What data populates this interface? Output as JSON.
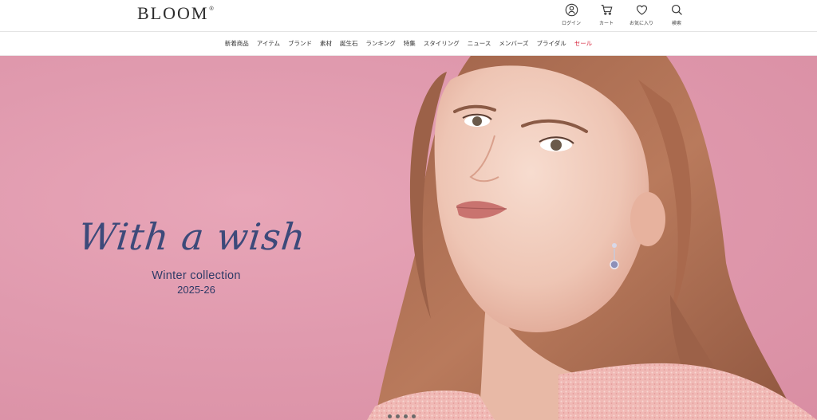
{
  "brand": {
    "name": "BL",
    "name_o": "O",
    "name_end": "OM",
    "registered": "®"
  },
  "utility": [
    {
      "id": "login",
      "label": "ログイン",
      "icon": "user-circle-icon"
    },
    {
      "id": "cart",
      "label": "カート",
      "icon": "cart-icon"
    },
    {
      "id": "favorites",
      "label": "お気に入り",
      "icon": "heart-icon"
    },
    {
      "id": "search",
      "label": "検索",
      "icon": "search-icon"
    }
  ],
  "nav": {
    "items": [
      "新着商品",
      "アイテム",
      "ブランド",
      "素材",
      "誕生石",
      "ランキング",
      "特集",
      "スタイリング",
      "ニュース",
      "メンバーズ",
      "ブライダル"
    ],
    "sale": "セール"
  },
  "hero": {
    "script_title": "With a wish",
    "collection": "Winter collection",
    "season": "2025-26",
    "slides": 4
  },
  "colors": {
    "hero_bg": "#e09aae",
    "title": "#3d4a7a",
    "sale": "#d7263d"
  }
}
